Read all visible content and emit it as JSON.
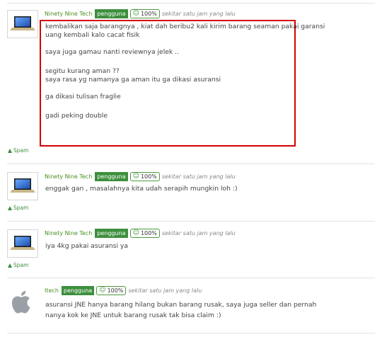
{
  "spam_label": "Spam",
  "reputation_icon": "smile-icon",
  "comments": [
    {
      "username": "Ninety Nine Tech",
      "role": "pengguna",
      "reputation": "100%",
      "time": "sekitar satu jam yang lalu",
      "avatar": "laptop-avatar",
      "lines": [
        "kembalikan saja barangnya , kiat dah beribu2 kali kirim barang seaman pakai garansi",
        "uang kembali kalo cacat fisik",
        "",
        "saya juga gamau nanti reviewnya jelek ..",
        "",
        "segitu kurang aman ??",
        "saya rasa yg namanya ga aman itu ga dikasi asuransi",
        "",
        "ga dikasi tulisan fraglie",
        "",
        "gadi peking double"
      ]
    },
    {
      "username": "Ninety Nine Tech",
      "role": "pengguna",
      "reputation": "100%",
      "time": "sekitar satu jam yang lalu",
      "avatar": "laptop-avatar",
      "lines": [
        "enggak gan , masalahnya kita udah serapih mungkin loh :)"
      ]
    },
    {
      "username": "Ninety Nine Tech",
      "role": "pengguna",
      "reputation": "100%",
      "time": "sekitar satu jam yang lalu",
      "avatar": "laptop-avatar",
      "lines": [
        "iya 4kg pakai asuransi ya"
      ]
    },
    {
      "username": "Itech",
      "role": "pengguna",
      "reputation": "100%",
      "time": "sekitar satu jam yang lalu",
      "avatar": "apple-logo-avatar",
      "lines": [
        "asuransi JNE hanya barang hilang bukan barang rusak, saya juga seller dan pernah",
        "nanya kok ke JNE untuk barang rusak tak bisa claim :)"
      ]
    }
  ]
}
